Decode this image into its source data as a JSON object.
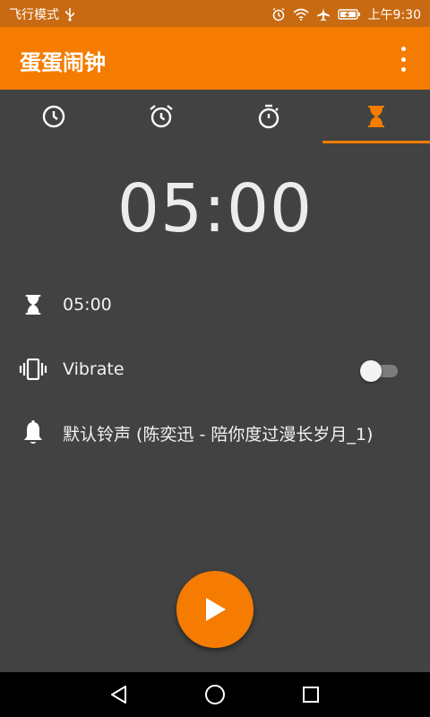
{
  "status_bar": {
    "airplane_mode_label": "飞行模式",
    "usb_icon": "usb-icon",
    "alarm_icon": "alarm-icon",
    "wifi_icon": "wifi-icon",
    "airplane_icon": "airplane-icon",
    "battery_icon": "battery-charging-icon",
    "time": "上午9:30"
  },
  "app_bar": {
    "title": "蛋蛋闹钟",
    "menu_icon": "overflow-menu-icon"
  },
  "tabs": [
    {
      "name": "clock",
      "icon": "clock-icon",
      "active": false
    },
    {
      "name": "alarm",
      "icon": "alarm-clock-icon",
      "active": false
    },
    {
      "name": "stopwatch",
      "icon": "stopwatch-icon",
      "active": false
    },
    {
      "name": "timer",
      "icon": "hourglass-icon",
      "active": true
    }
  ],
  "timer": {
    "display": "05:00"
  },
  "settings": {
    "duration": {
      "icon": "hourglass-icon",
      "value": "05:00"
    },
    "vibrate": {
      "icon": "vibrate-icon",
      "label": "Vibrate",
      "enabled": false
    },
    "ringtone": {
      "icon": "bell-icon",
      "label": "默认铃声 (陈奕迅 - 陪你度过漫长岁月_1)"
    }
  },
  "fab": {
    "icon": "play-icon"
  },
  "nav_bar": {
    "back_icon": "back-icon",
    "home_icon": "home-icon",
    "recents_icon": "recents-icon"
  },
  "colors": {
    "accent": "#f57c00",
    "status_bar": "#c86a12",
    "background": "#424242",
    "inactive_icon": "#ffffff",
    "nav_bar": "#000000"
  }
}
